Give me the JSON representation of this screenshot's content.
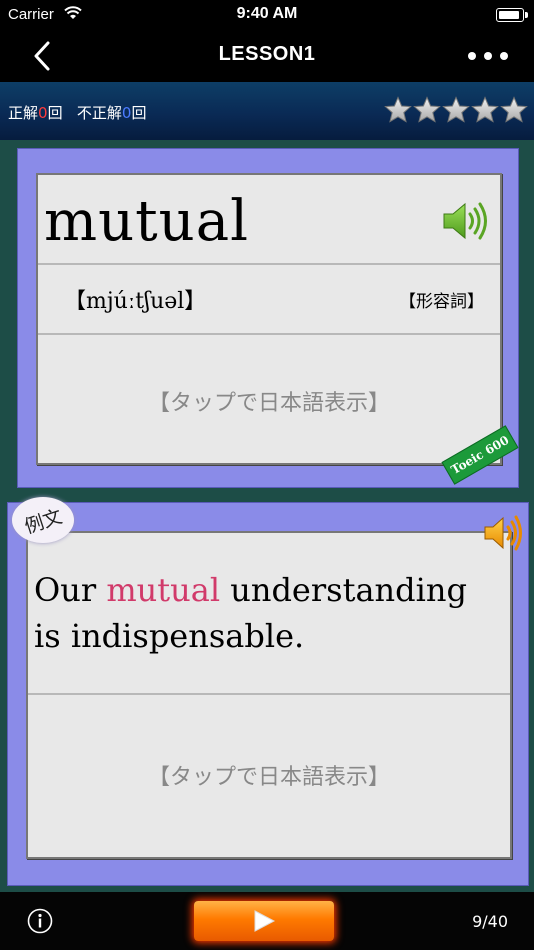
{
  "status_bar": {
    "carrier": "Carrier",
    "time": "9:40 AM"
  },
  "nav": {
    "title": "LESSON1"
  },
  "score": {
    "correct_label": "正解",
    "correct_count": "0",
    "incorrect_label": "不正解",
    "incorrect_count": "0",
    "unit": "回",
    "stars_total": 5,
    "stars_filled": 0
  },
  "word_card": {
    "word": "mutual",
    "phonetic": "【mjúːtʃuəl】",
    "part_of_speech": "【形容詞】",
    "tap_hint": "【タップで日本語表示】",
    "tag": "Toeic 600"
  },
  "example_card": {
    "badge": "例文",
    "sentence_before": "Our ",
    "sentence_highlight": "mutual",
    "sentence_after": " understanding is indispensable.",
    "tap_hint": "【タップで日本語表示】"
  },
  "bottom": {
    "counter": "9/40"
  },
  "colors": {
    "highlight": "#d13a6a",
    "card": "#8a8be8",
    "background": "#1d4d47",
    "play": "#ff7a00"
  },
  "icons": [
    "wifi-icon",
    "battery-icon",
    "back-chevron-icon",
    "more-icon",
    "star-icon",
    "speaker-icon",
    "info-icon",
    "play-icon"
  ]
}
